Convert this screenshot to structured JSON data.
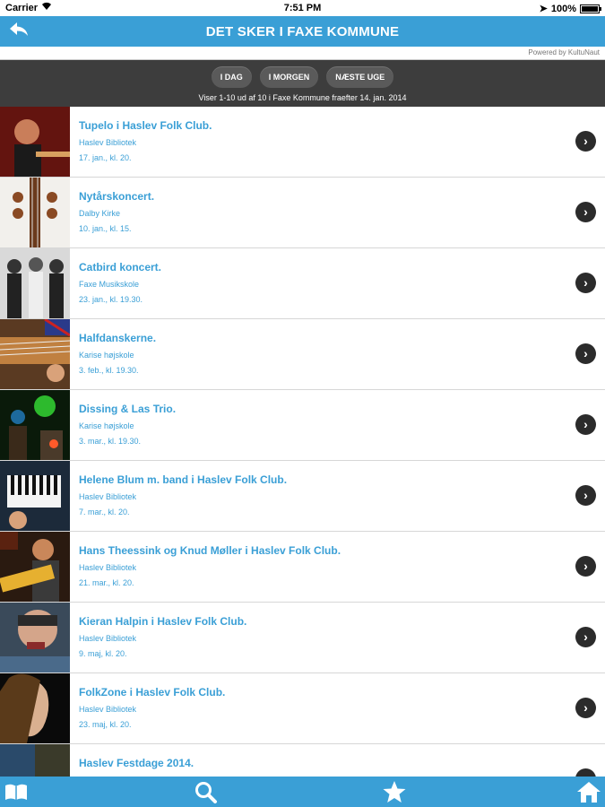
{
  "status_bar": {
    "carrier": "Carrier",
    "time": "7:51 PM",
    "battery": "100%"
  },
  "nav": {
    "title": "DET SKER I FAXE KOMMUNE",
    "back_icon": "back-arrow-icon"
  },
  "powered_by": "Powered by KultuNaut",
  "filters": {
    "today": "I DAG",
    "tomorrow": "I MORGEN",
    "next_week": "NÆSTE UGE"
  },
  "results_info": "Viser 1-10 ud af 10 i Faxe Kommune fraefter 14. jan. 2014",
  "events": [
    {
      "title": "Tupelo i Haslev Folk Club.",
      "venue": "Haslev Bibliotek",
      "date": "17. jan., kl. 20."
    },
    {
      "title": "Nytårskoncert.",
      "venue": "Dalby Kirke",
      "date": "10. jan., kl. 15."
    },
    {
      "title": "Catbird koncert.",
      "venue": "Faxe Musikskole",
      "date": "23. jan., kl. 19.30."
    },
    {
      "title": "Halfdanskerne.",
      "venue": "Karise højskole",
      "date": "3. feb., kl. 19.30."
    },
    {
      "title": "Dissing & Las Trio.",
      "venue": "Karise højskole",
      "date": "3. mar., kl. 19.30."
    },
    {
      "title": "Helene Blum m. band i Haslev Folk Club.",
      "venue": "Haslev Bibliotek",
      "date": "7. mar., kl. 20."
    },
    {
      "title": "Hans Theessink og Knud Møller i Haslev Folk Club.",
      "venue": "Haslev Bibliotek",
      "date": "21. mar., kl. 20."
    },
    {
      "title": "Kieran Halpin i Haslev Folk Club.",
      "venue": "Haslev Bibliotek",
      "date": "9. maj, kl. 20."
    },
    {
      "title": "FolkZone i Haslev Folk Club.",
      "venue": "Haslev Bibliotek",
      "date": "23. maj, kl. 20."
    },
    {
      "title": "Haslev Festdage 2014.",
      "venue": "",
      "date": ""
    }
  ],
  "tabbar": {
    "items": [
      "book-icon",
      "search-icon",
      "star-icon",
      "home-icon"
    ]
  },
  "colors": {
    "accent": "#3a9fd6",
    "filter_bar": "#3d3d3d",
    "chevron": "#2b2b2b"
  }
}
